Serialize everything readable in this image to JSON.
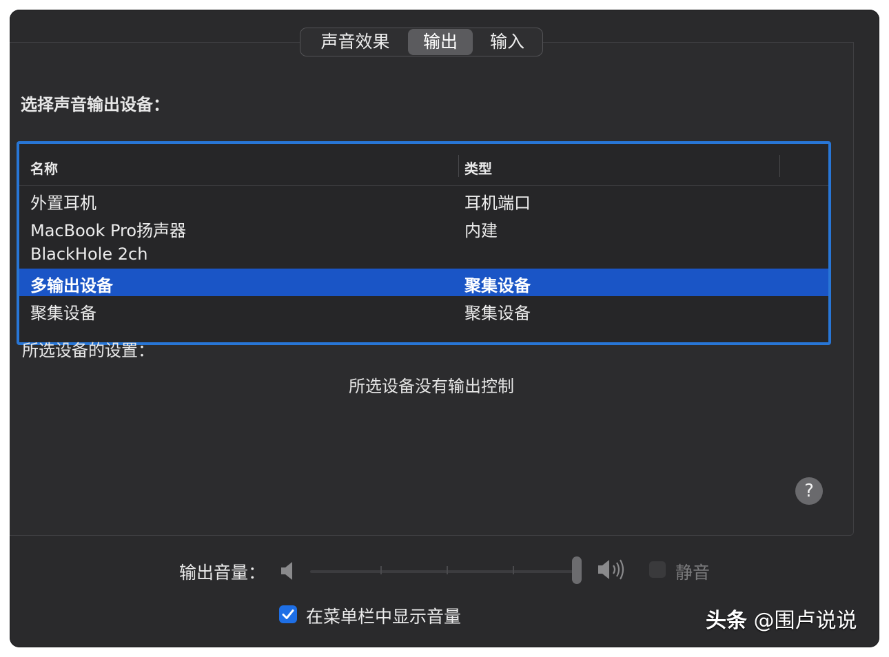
{
  "tabs": [
    {
      "label": "声音效果",
      "active": false
    },
    {
      "label": "输出",
      "active": true
    },
    {
      "label": "输入",
      "active": false
    }
  ],
  "output": {
    "select_label": "选择声音输出设备：",
    "columns": {
      "name": "名称",
      "type": "类型"
    },
    "devices": [
      {
        "name": "外置耳机",
        "type": "耳机端口",
        "selected": false
      },
      {
        "name": "MacBook Pro扬声器",
        "type": "内建",
        "selected": false
      },
      {
        "name": "BlackHole 2ch",
        "type": "",
        "selected": false
      },
      {
        "name": "多输出设备",
        "type": "聚集设备",
        "selected": true
      },
      {
        "name": "聚集设备",
        "type": "聚集设备",
        "selected": false
      }
    ],
    "settings_label": "所选设备的设置：",
    "no_controls_message": "所选设备没有输出控制",
    "help_label": "?"
  },
  "volume": {
    "label": "输出音量：",
    "level": 1.0,
    "mute_label": "静音",
    "muted": false,
    "disabled": true
  },
  "menu_bar": {
    "label": "在菜单栏中显示音量",
    "checked": true
  },
  "watermark": {
    "brand": "头条",
    "handle": "@围卢说说"
  },
  "colors": {
    "accent": "#2876d6",
    "selection": "#1a55c6",
    "window_bg": "#2a2a2c"
  }
}
